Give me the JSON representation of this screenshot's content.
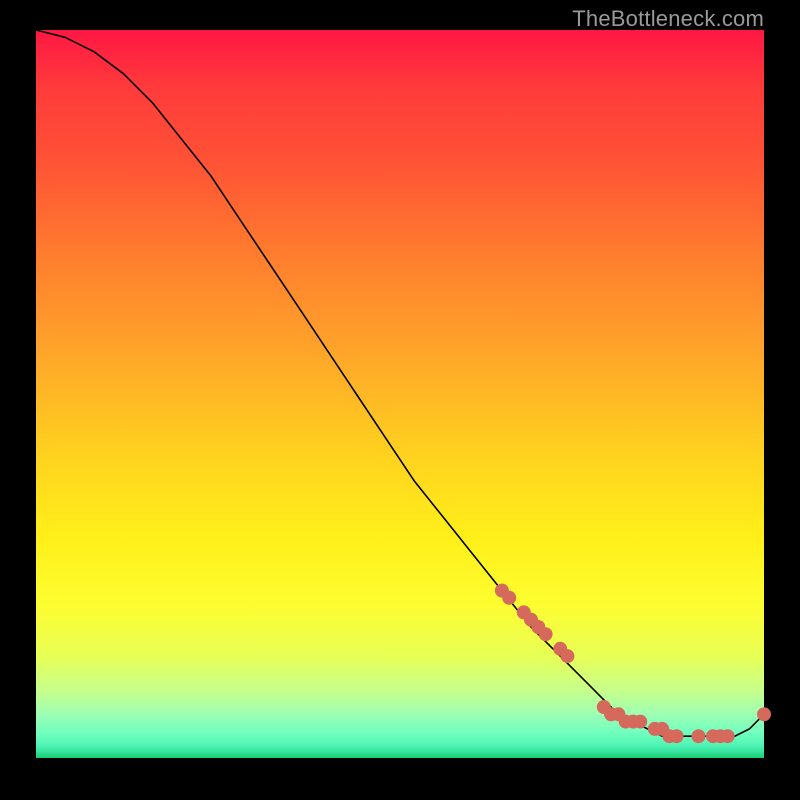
{
  "watermark": "TheBottleneck.com",
  "colors": {
    "dot": "#d5695c",
    "line": "#000000"
  },
  "chart_data": {
    "type": "line",
    "title": "",
    "xlabel": "",
    "ylabel": "",
    "xlim": [
      0,
      100
    ],
    "ylim": [
      0,
      100
    ],
    "grid": false,
    "legend": false,
    "series": [
      {
        "name": "bottleneck-curve",
        "x": [
          0,
          4,
          8,
          12,
          16,
          20,
          24,
          28,
          32,
          36,
          40,
          44,
          48,
          52,
          56,
          60,
          64,
          68,
          72,
          74,
          76,
          78,
          80,
          82,
          84,
          86,
          88,
          90,
          92,
          94,
          96,
          98,
          100
        ],
        "y": [
          100,
          99,
          97,
          94,
          90,
          85,
          80,
          74,
          68,
          62,
          56,
          50,
          44,
          38,
          33,
          28,
          23,
          18,
          14,
          12,
          10,
          8,
          6,
          5,
          4,
          3,
          3,
          3,
          3,
          3,
          3,
          4,
          6
        ]
      }
    ],
    "scatter_points": {
      "name": "highlighted-points",
      "x": [
        64,
        65,
        67,
        68,
        69,
        70,
        72,
        73,
        78,
        79,
        80,
        81,
        82,
        83,
        85,
        86,
        87,
        88,
        91,
        93,
        94,
        95,
        100
      ],
      "y": [
        23,
        22,
        20,
        19,
        18,
        17,
        15,
        14,
        7,
        6,
        6,
        5,
        5,
        5,
        4,
        4,
        3,
        3,
        3,
        3,
        3,
        3,
        6
      ]
    }
  }
}
